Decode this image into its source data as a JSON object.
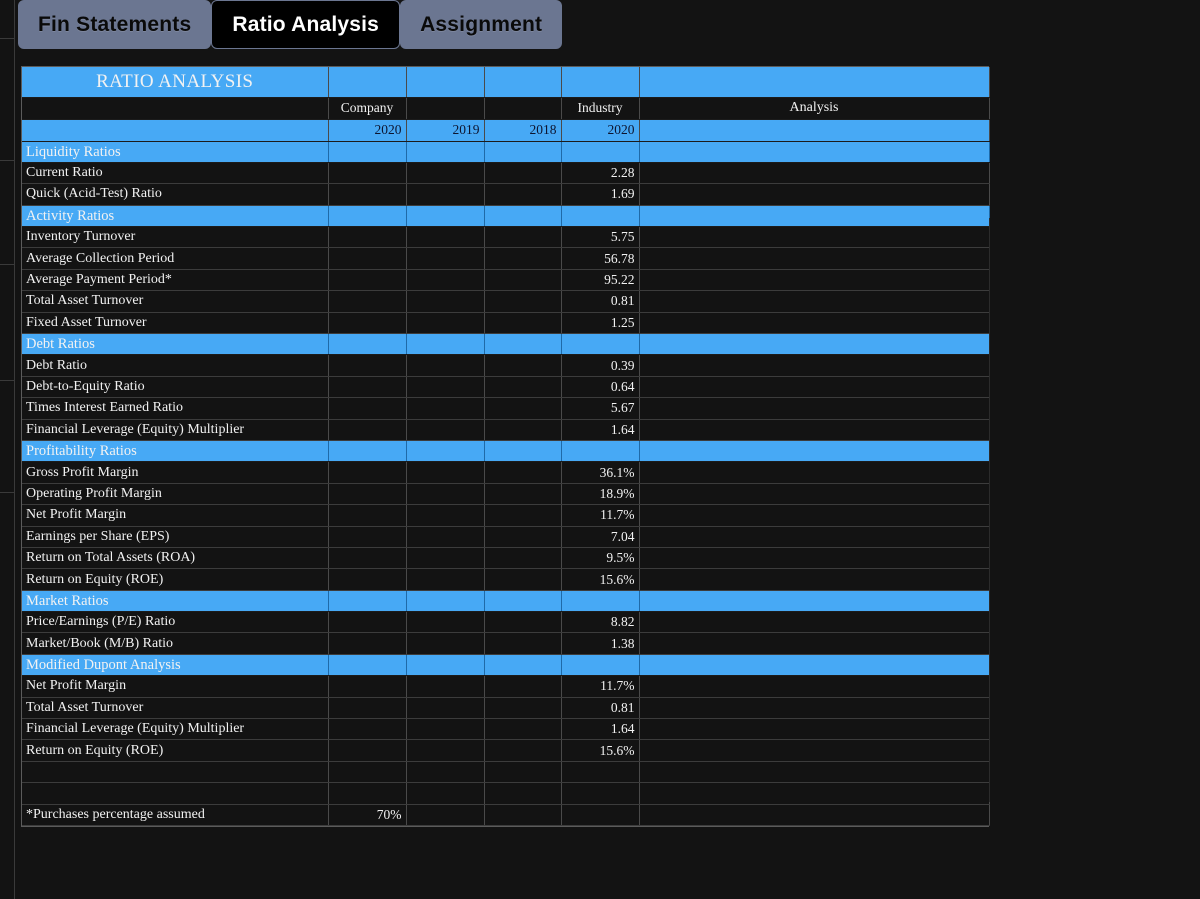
{
  "tabs": [
    {
      "label": "Fin Statements",
      "active": false
    },
    {
      "label": "Ratio Analysis",
      "active": true
    },
    {
      "label": "Assignment",
      "active": false
    }
  ],
  "sheet": {
    "title": "RATIO ANALYSIS",
    "group_headers": {
      "company": "Company",
      "industry": "Industry",
      "analysis": "Analysis"
    },
    "year_headers": {
      "company_2020": "2020",
      "company_2019": "2019",
      "company_2018": "2018",
      "industry_2020": "2020"
    },
    "colors": {
      "header_blue": "#47a9f5",
      "company_blue": "#3f9fe8",
      "mid_blue": "#0d8bd0",
      "industry_olive": "#1c1b0a",
      "analysis_pink": "#feb4b4",
      "row_dark": "#131313",
      "tab_inactive": "#6b7691",
      "tab_active": "#000000"
    },
    "sections": [
      {
        "name": "Liquidity Ratios",
        "rows": [
          {
            "label": "Current Ratio",
            "c2020": "",
            "c2019": "",
            "c2018": "",
            "industry": "2.28",
            "analysis": ""
          },
          {
            "label": "Quick (Acid-Test) Ratio",
            "c2020": "",
            "c2019": "",
            "c2018": "",
            "industry": "1.69",
            "analysis": ""
          }
        ]
      },
      {
        "name": "Activity Ratios",
        "rows": [
          {
            "label": "Inventory Turnover",
            "c2020": "",
            "c2019": "",
            "c2018": "",
            "industry": "5.75",
            "analysis": ""
          },
          {
            "label": "Average Collection Period",
            "c2020": "",
            "c2019": "",
            "c2018": "",
            "industry": "56.78",
            "analysis": ""
          },
          {
            "label": "Average Payment Period*",
            "c2020": "",
            "c2019": "",
            "c2018": "",
            "industry": "95.22",
            "analysis": ""
          },
          {
            "label": "Total Asset Turnover",
            "c2020": "",
            "c2019": "",
            "c2018": "",
            "industry": "0.81",
            "analysis": ""
          },
          {
            "label": "Fixed Asset Turnover",
            "c2020": "",
            "c2019": "",
            "c2018": "",
            "industry": "1.25",
            "analysis": ""
          }
        ]
      },
      {
        "name": "Debt Ratios",
        "rows": [
          {
            "label": "Debt Ratio",
            "c2020": "",
            "c2019": "",
            "c2018": "",
            "industry": "0.39",
            "analysis": ""
          },
          {
            "label": "Debt-to-Equity Ratio",
            "c2020": "",
            "c2019": "",
            "c2018": "",
            "industry": "0.64",
            "analysis": ""
          },
          {
            "label": "Times Interest Earned Ratio",
            "c2020": "",
            "c2019": "",
            "c2018": "",
            "industry": "5.67",
            "analysis": ""
          },
          {
            "label": "Financial Leverage (Equity) Multiplier",
            "c2020": "",
            "c2019": "",
            "c2018": "",
            "industry": "1.64",
            "analysis": ""
          }
        ]
      },
      {
        "name": "Profitability Ratios",
        "rows": [
          {
            "label": "Gross Profit Margin",
            "c2020": "",
            "c2019": "",
            "c2018": "",
            "industry": "36.1%",
            "analysis": ""
          },
          {
            "label": "Operating Profit Margin",
            "c2020": "",
            "c2019": "",
            "c2018": "",
            "industry": "18.9%",
            "analysis": ""
          },
          {
            "label": "Net Profit Margin",
            "c2020": "",
            "c2019": "",
            "c2018": "",
            "industry": "11.7%",
            "analysis": ""
          },
          {
            "label": "Earnings per Share (EPS)",
            "c2020": "",
            "c2019": "",
            "c2018": "",
            "industry": "7.04",
            "analysis": ""
          },
          {
            "label": "Return on Total Assets (ROA)",
            "c2020": "",
            "c2019": "",
            "c2018": "",
            "industry": "9.5%",
            "analysis": ""
          },
          {
            "label": "Return on Equity (ROE)",
            "c2020": "",
            "c2019": "",
            "c2018": "",
            "industry": "15.6%",
            "analysis": ""
          }
        ]
      },
      {
        "name": "Market Ratios",
        "rows": [
          {
            "label": "Price/Earnings (P/E) Ratio",
            "c2020": "",
            "c2019": "",
            "c2018": "",
            "industry": "8.82",
            "analysis": ""
          },
          {
            "label": "Market/Book (M/B) Ratio",
            "c2020": "",
            "c2019": "",
            "c2018": "",
            "industry": "1.38",
            "analysis": ""
          }
        ]
      },
      {
        "name": "Modified Dupont Analysis",
        "rows": [
          {
            "label": "Net Profit Margin",
            "c2020": "",
            "c2019": "",
            "c2018": "",
            "industry": "11.7%",
            "analysis": ""
          },
          {
            "label": "Total Asset Turnover",
            "c2020": "",
            "c2019": "",
            "c2018": "",
            "industry": "0.81",
            "analysis": ""
          },
          {
            "label": "Financial Leverage (Equity) Multiplier",
            "c2020": "",
            "c2019": "",
            "c2018": "",
            "industry": "1.64",
            "analysis": ""
          },
          {
            "label": "Return on Equity (ROE)",
            "c2020": "",
            "c2019": "",
            "c2018": "",
            "industry": "15.6%",
            "analysis": ""
          }
        ]
      }
    ],
    "footnote": {
      "label": "*Purchases percentage assumed",
      "value": "70%"
    }
  }
}
